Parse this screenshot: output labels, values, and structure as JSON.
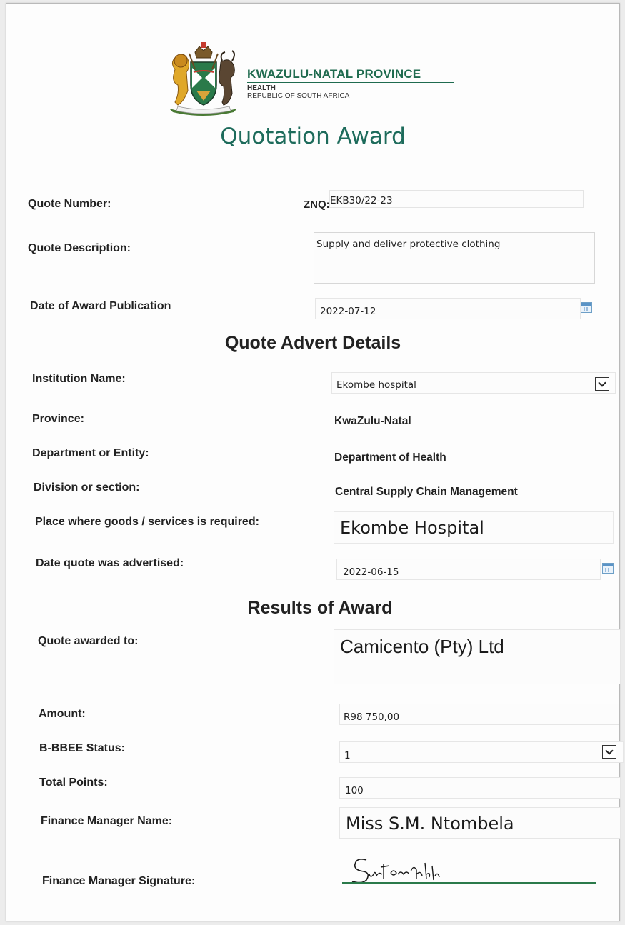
{
  "header": {
    "province": "KWAZULU-NATAL PROVINCE",
    "department": "HEALTH",
    "country": "REPUBLIC OF SOUTH AFRICA",
    "title": "Quotation Award"
  },
  "quote": {
    "number_label": "Quote Number:",
    "number_prefix": "ZNQ:",
    "number_value": "EKB30/22-23",
    "description_label": "Quote Description:",
    "description_value": "Supply and deliver protective clothing",
    "award_date_label": "Date of Award Publication",
    "award_date_value": "2022-07-12"
  },
  "advert": {
    "heading": "Quote Advert Details",
    "institution_label": "Institution Name:",
    "institution_value": "Ekombe hospital",
    "province_label": "Province:",
    "province_value": "KwaZulu-Natal",
    "department_label": "Department or Entity:",
    "department_value": "Department of Health",
    "division_label": "Division or section:",
    "division_value": "Central Supply Chain Management",
    "place_label": "Place where goods /  services is required:",
    "place_value": "Ekombe Hospital",
    "advertised_label": "Date quote was advertised:",
    "advertised_value": "2022-06-15"
  },
  "results": {
    "heading": "Results of Award",
    "awarded_to_label": "Quote awarded to:",
    "awarded_to_value": "Camicento (Pty) Ltd",
    "amount_label": "Amount:",
    "amount_value": "R98 750,00",
    "bbbee_label": "B-BBEE Status:",
    "bbbee_value": "1",
    "points_label": "Total Points:",
    "points_value": "100",
    "fm_name_label": "Finance Manager Name:",
    "fm_name_value": "Miss S.M. Ntombela",
    "fm_signature_label": "Finance Manager Signature:"
  },
  "colors": {
    "brand_green": "#1f6b4f",
    "title_teal": "#1d6b5b"
  }
}
